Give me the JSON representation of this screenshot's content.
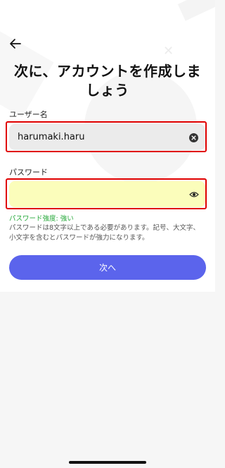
{
  "header": {
    "title": "次に、アカウントを作成しましょう"
  },
  "form": {
    "username": {
      "label": "ユーザー名",
      "value": "harumaki.haru",
      "clear_icon": "clear-circle-icon"
    },
    "password": {
      "label": "パスワード",
      "value": "",
      "toggle_icon": "eye-icon"
    },
    "strength_text": "パスワード強度: 強い",
    "help_text": "パスワードは8文字以上である必要があります。記号、大文字、小文字を含むとパスワードが強力になります。",
    "submit_label": "次へ"
  },
  "colors": {
    "accent": "#5b64ec",
    "highlight": "#e00000",
    "password_field_bg": "#fbfdbb",
    "strength_ok": "#27a83a"
  }
}
